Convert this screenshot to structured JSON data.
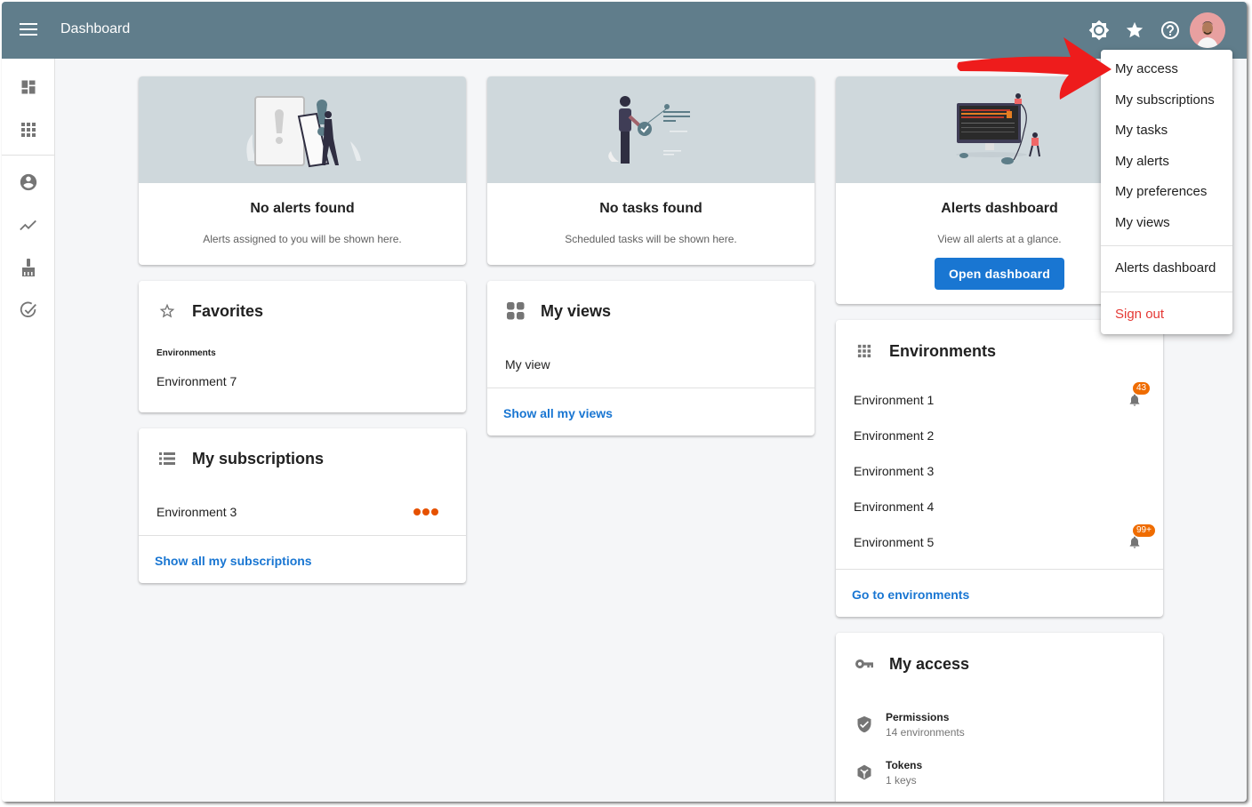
{
  "header": {
    "title": "Dashboard",
    "icons": [
      "brightness-icon",
      "star-icon",
      "help-icon",
      "user-avatar"
    ]
  },
  "sidebar": {
    "items": [
      {
        "icon": "dashboard-icon"
      },
      {
        "icon": "apps-grid-icon"
      },
      {
        "icon": "account-circle-icon"
      },
      {
        "icon": "trending-icon"
      },
      {
        "icon": "cleaning-brush-icon"
      },
      {
        "icon": "check-circle-icon"
      }
    ]
  },
  "cards": {
    "alerts": {
      "title": "No alerts found",
      "subtitle": "Alerts assigned to you will be shown here."
    },
    "tasks": {
      "title": "No tasks found",
      "subtitle": "Scheduled tasks will be shown here."
    },
    "alerts_dashboard": {
      "title": "Alerts dashboard",
      "subtitle": "View all alerts at a glance.",
      "button_label": "Open dashboard"
    },
    "favorites": {
      "title": "Favorites",
      "section_label": "Environments",
      "items": [
        "Environment 7"
      ]
    },
    "subscriptions": {
      "title": "My subscriptions",
      "items": [
        "Environment 3"
      ],
      "link_label": "Show all my subscriptions"
    },
    "views": {
      "title": "My views",
      "items": [
        "My view"
      ],
      "link_label": "Show all my views"
    },
    "environments": {
      "title": "Environments",
      "items": [
        {
          "name": "Environment 1",
          "alert_badge": "43"
        },
        {
          "name": "Environment 2",
          "alert_badge": null
        },
        {
          "name": "Environment 3",
          "alert_badge": null
        },
        {
          "name": "Environment 4",
          "alert_badge": null
        },
        {
          "name": "Environment 5",
          "alert_badge": "99+"
        }
      ],
      "link_label": "Go to environments"
    },
    "access": {
      "title": "My access",
      "items": [
        {
          "title": "Permissions",
          "subtitle": "14 environments"
        },
        {
          "title": "Tokens",
          "subtitle": "1 keys"
        }
      ]
    }
  },
  "user_menu": {
    "items": [
      "My access",
      "My subscriptions",
      "My tasks",
      "My alerts",
      "My preferences",
      "My views"
    ],
    "secondary": [
      "Alerts dashboard"
    ],
    "sign_out": "Sign out"
  },
  "colors": {
    "topbar": "#607d8b",
    "link": "#1976d2",
    "badge": "#ef6c00",
    "danger": "#e53935",
    "annotation_arrow": "#ee1c1c"
  }
}
